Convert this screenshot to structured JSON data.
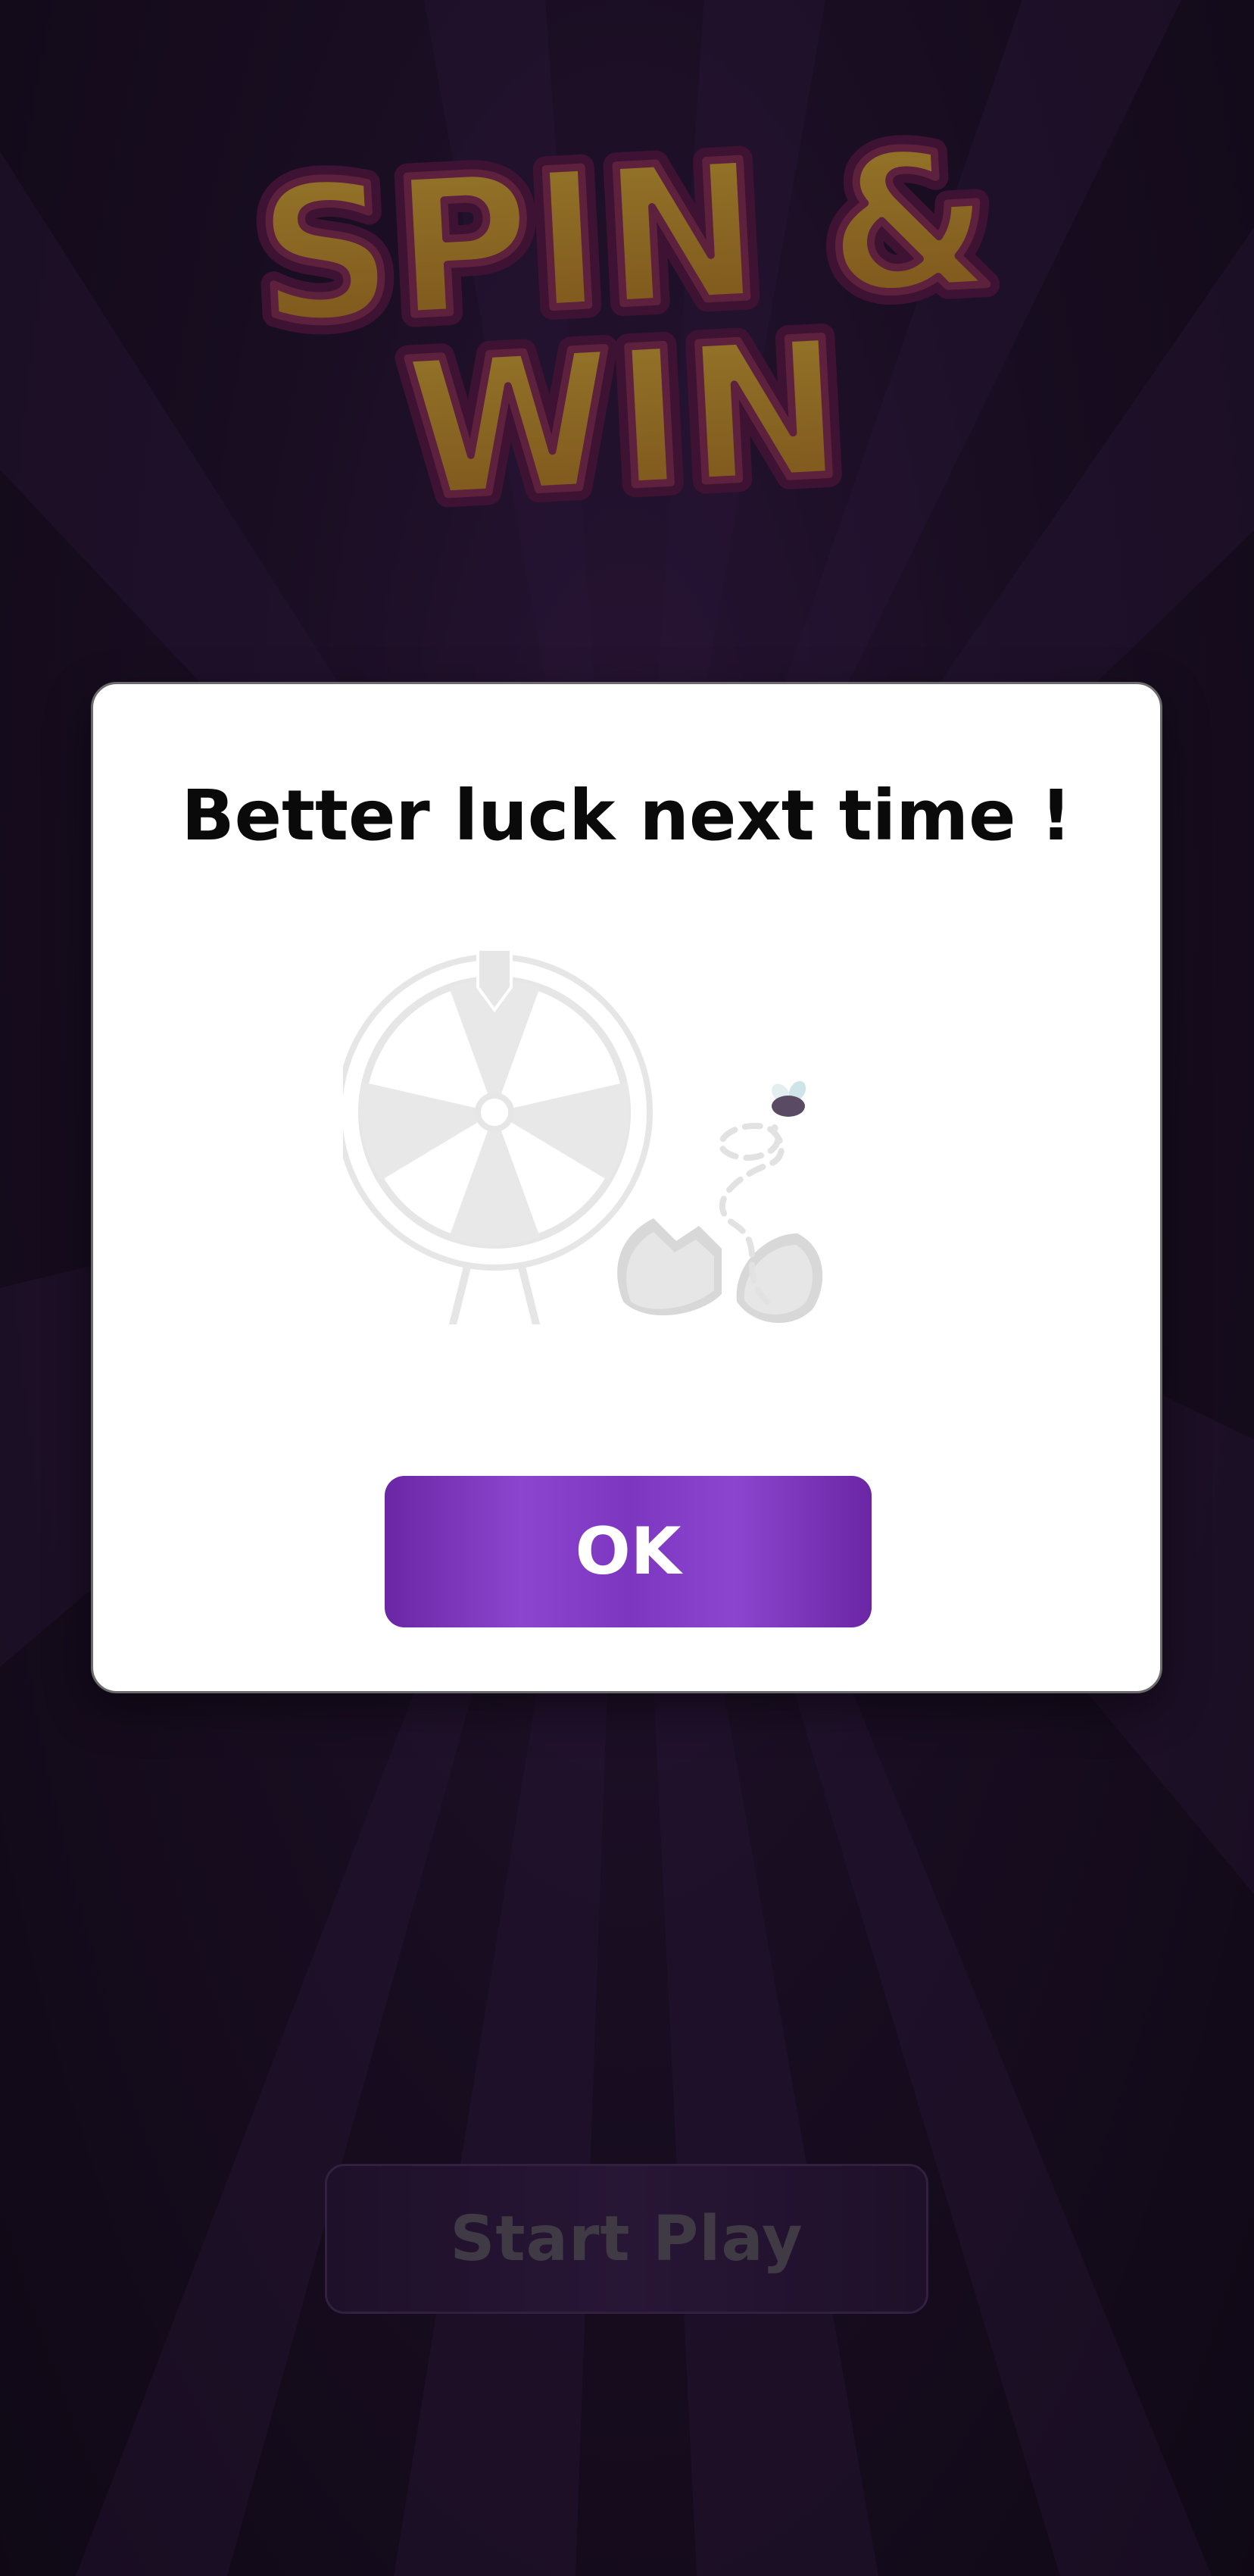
{
  "game": {
    "logo_line1": "SPIN &",
    "logo_line2": "WIN"
  },
  "start_button": {
    "label": "Start Play"
  },
  "dialog": {
    "title": "Better luck next time !",
    "ok_label": "OK"
  },
  "colors": {
    "background": "#1a1020",
    "logo_fill": "#d3a12e",
    "logo_outline": "#7a2552",
    "button_purple": "#7c36bf",
    "dialog_bg": "#ffffff"
  },
  "icons": {
    "illustration": "empty-prize-wheel-with-cracked-egg-and-fly"
  }
}
